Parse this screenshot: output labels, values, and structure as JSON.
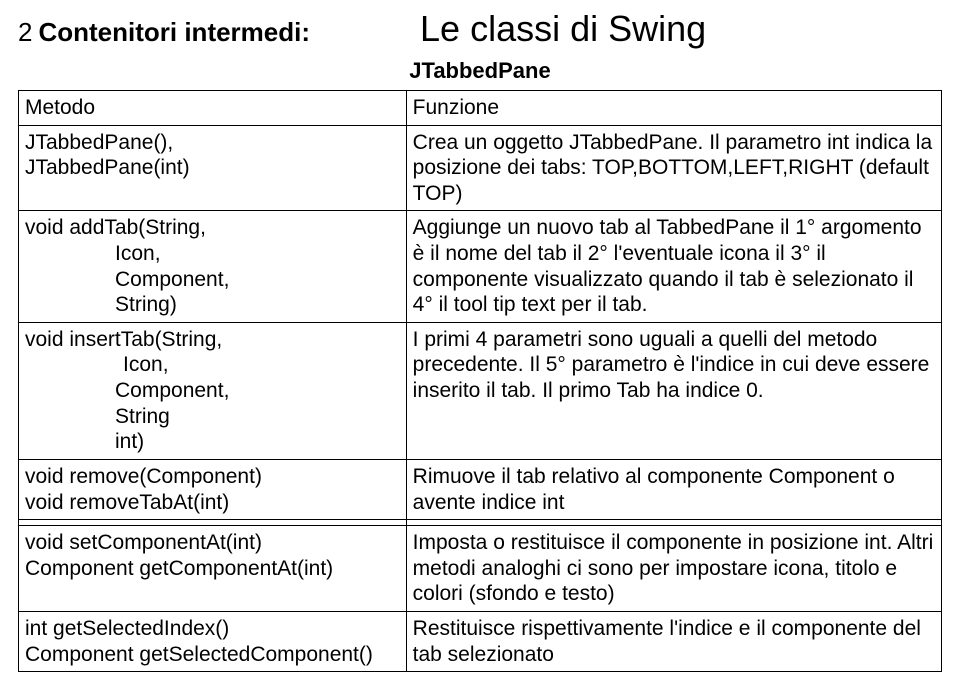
{
  "pageNumber": "2",
  "subtitle": "Contenitori intermedi:",
  "title": "Le classi di Swing",
  "tableName": "JTabbedPane",
  "headers": {
    "method": "Metodo",
    "func": "Funzione"
  },
  "rows": [
    {
      "m": [
        "JTabbedPane(),",
        "JTabbedPane(int)"
      ],
      "f": "Crea un oggetto JTabbedPane. Il parametro int indica la posizione dei tabs: TOP,BOTTOM,LEFT,RIGHT (default TOP)"
    },
    {
      "m": {
        "l1": "void addTab(String,",
        "l2": "Icon,",
        "l3": "Component,",
        "l4": "String)"
      },
      "f": "Aggiunge un nuovo tab al TabbedPane il 1° argomento è il nome del tab il 2° l'eventuale icona il 3° il componente visualizzato quando il tab è selezionato il 4° il tool tip text per il tab."
    },
    {
      "m": {
        "l1": "void insertTab(String,",
        "l2": "Icon,",
        "l3": "Component,",
        "l4": "String",
        "l5": "int)"
      },
      "f": "I primi 4 parametri sono uguali a quelli del metodo precedente. Il 5° parametro è l'indice in cui deve essere inserito il tab. Il primo Tab ha indice 0."
    },
    {
      "m": [
        "void remove(Component)",
        "void removeTabAt(int)"
      ],
      "f": "Rimuove il tab relativo al componente Component o avente indice int"
    },
    {
      "m": [
        "void setComponentAt(int)",
        "Component getComponentAt(int)"
      ],
      "f": "Imposta o restituisce il componente in posizione int. Altri metodi analoghi ci sono per impostare icona, titolo e colori (sfondo e testo)"
    },
    {
      "m": [
        "int getSelectedIndex()",
        "Component getSelectedComponent()"
      ],
      "f": "Restituisce rispettivamente l'indice e il componente del tab selezionato"
    }
  ]
}
